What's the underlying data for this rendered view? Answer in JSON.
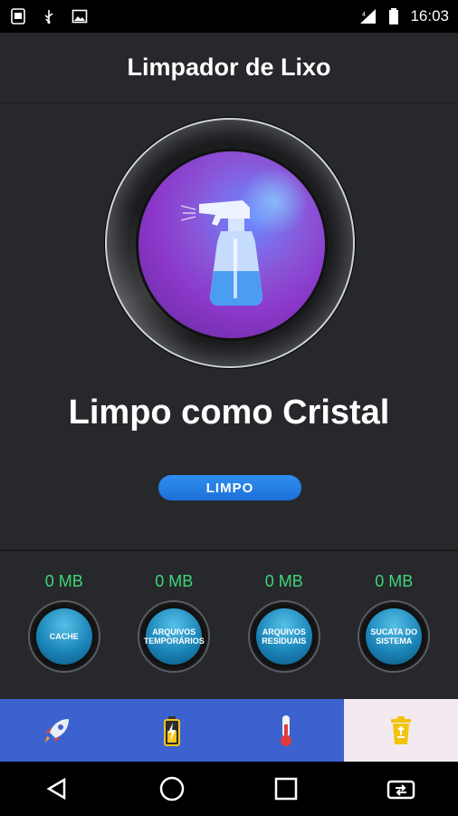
{
  "status_bar": {
    "time": "16:03",
    "left_icons": [
      "sim-card-icon",
      "usb-icon",
      "image-icon"
    ],
    "right_icons": [
      "signal-icon",
      "battery-icon"
    ]
  },
  "app": {
    "title": "Limpador de Lixo"
  },
  "hero": {
    "icon": "spray-bottle-icon",
    "headline": "Limpo como Cristal",
    "state_label": "LIMPO"
  },
  "categories": [
    {
      "size": "0 MB",
      "label": "CACHE"
    },
    {
      "size": "0 MB",
      "label": "ARQUIVOS TEMPORÁRIOS"
    },
    {
      "size": "0 MB",
      "label": "ARQUIVOS RESIDUAIS"
    },
    {
      "size": "0 MB",
      "label": "SUCATA DO SISTEMA"
    }
  ],
  "bottom_nav": {
    "items": [
      {
        "icon": "rocket-icon"
      },
      {
        "icon": "battery-charging-icon"
      },
      {
        "icon": "thermometer-icon"
      },
      {
        "icon": "recycle-bin-icon",
        "active": true
      }
    ]
  },
  "system_nav": [
    "back-icon",
    "home-icon",
    "recents-icon",
    "switch-app-icon"
  ],
  "colors": {
    "background": "#26282b",
    "accent_blue": "#3c62cf",
    "size_green": "#3fd67a",
    "pill_blue": "#2f8ff0"
  }
}
